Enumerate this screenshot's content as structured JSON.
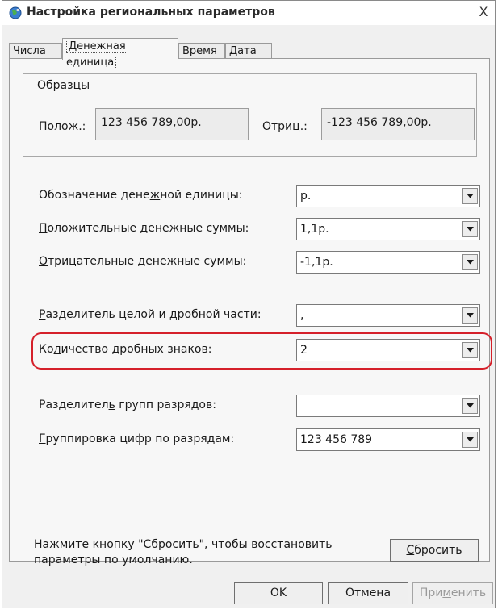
{
  "window": {
    "title": "Настройка региональных параметров",
    "close_glyph": "X"
  },
  "tabs": [
    {
      "label": "Числа"
    },
    {
      "label": "Денежная единица"
    },
    {
      "label": "Время"
    },
    {
      "label": "Дата"
    }
  ],
  "samples": {
    "legend": "Образцы",
    "positive_label": "Полож.:",
    "positive_value": "123 456 789,00р.",
    "negative_label": "Отриц.:",
    "negative_value": "-123 456 789,00р."
  },
  "settings": [
    {
      "pre": "Обозначение дене",
      "u": "ж",
      "post": "ной единицы:",
      "value": "р."
    },
    {
      "pre": "",
      "u": "П",
      "post": "оложительные денежные суммы:",
      "value": "1,1р."
    },
    {
      "pre": "",
      "u": "О",
      "post": "трицательные денежные суммы:",
      "value": "-1,1р."
    },
    {
      "pre": "",
      "u": "Р",
      "post": "азделитель целой и дробной части:",
      "value": ","
    },
    {
      "pre": "Ко",
      "u": "л",
      "post": "ичество дробных знаков:",
      "value": "2"
    },
    {
      "pre": "Разделител",
      "u": "ь",
      "post": " групп разрядов:",
      "value": ""
    },
    {
      "pre": "",
      "u": "Г",
      "post": "руппировка цифр по разрядам:",
      "value": "123 456 789"
    }
  ],
  "footer": {
    "hint_line1": "Нажмите кнопку \"Сбросить\", чтобы восстановить",
    "hint_line2": "параметры по умолчанию.",
    "reset_pre": "",
    "reset_u": "С",
    "reset_post": "бросить"
  },
  "buttons": {
    "ok": "OK",
    "cancel": "Отмена",
    "apply_pre": "При",
    "apply_u": "м",
    "apply_post": "енить"
  },
  "colors": {
    "highlight": "#d5202a"
  }
}
